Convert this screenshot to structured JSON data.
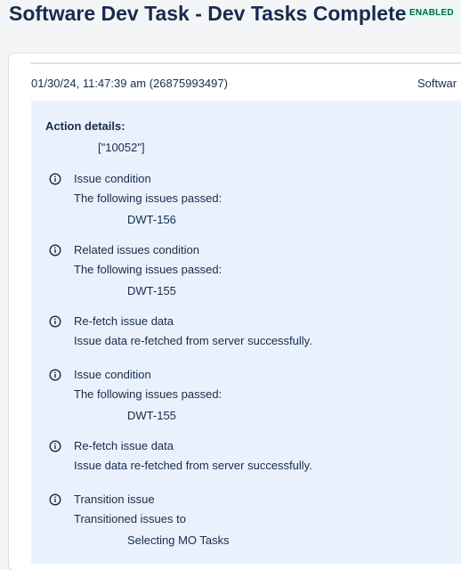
{
  "header": {
    "title": "Software Dev Task - Dev Tasks Complete",
    "status_badge": "ENABLED"
  },
  "log": {
    "timestamp": "01/30/24, 11:47:39 am (26875993497)",
    "rule_name": "Softwar",
    "action_details_label": "Action details:",
    "action_details_value": "[\"10052\"]",
    "entries": [
      {
        "icon": "info-icon",
        "title": "Issue condition",
        "description": "The following issues passed:",
        "item": "DWT-156"
      },
      {
        "icon": "info-icon",
        "title": "Related issues condition",
        "description": "The following issues passed:",
        "item": "DWT-155"
      },
      {
        "icon": "info-icon",
        "title": "Re-fetch issue data",
        "description": "Issue data re-fetched from server successfully.",
        "item": ""
      },
      {
        "icon": "info-icon",
        "title": "Issue condition",
        "description": "The following issues passed:",
        "item": "DWT-155"
      },
      {
        "icon": "info-icon",
        "title": "Re-fetch issue data",
        "description": "Issue data re-fetched from server successfully.",
        "item": ""
      },
      {
        "icon": "info-icon",
        "title": "Transition issue",
        "description": "Transitioned issues to",
        "item": "Selecting MO Tasks"
      }
    ]
  },
  "colors": {
    "text": "#172b4d",
    "badge_text": "#006644",
    "badge_bg": "#e3fcef",
    "details_bg": "#e9f2fc",
    "page_bg": "#f4f5f7"
  }
}
